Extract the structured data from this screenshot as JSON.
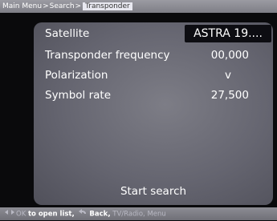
{
  "breadcrumb": {
    "items": [
      "Main Menu",
      "Search",
      "Transponder"
    ]
  },
  "rows": [
    {
      "label": "Satellite",
      "value": "ASTRA 19...."
    },
    {
      "label": "Transponder frequency",
      "value": "00,000"
    },
    {
      "label": "Polarization",
      "value": "v"
    },
    {
      "label": "Symbol rate",
      "value": "27,500"
    }
  ],
  "start_search": "Start search",
  "footer": {
    "ok": "OK",
    "open_list": "to open list,",
    "back": "Back,",
    "tv_radio": "TV/Radio,",
    "menu": "Menu"
  },
  "colors": {
    "panel": "#6e6e78",
    "bars": "#85858d",
    "selected_value_bg": "#0d0d12"
  }
}
